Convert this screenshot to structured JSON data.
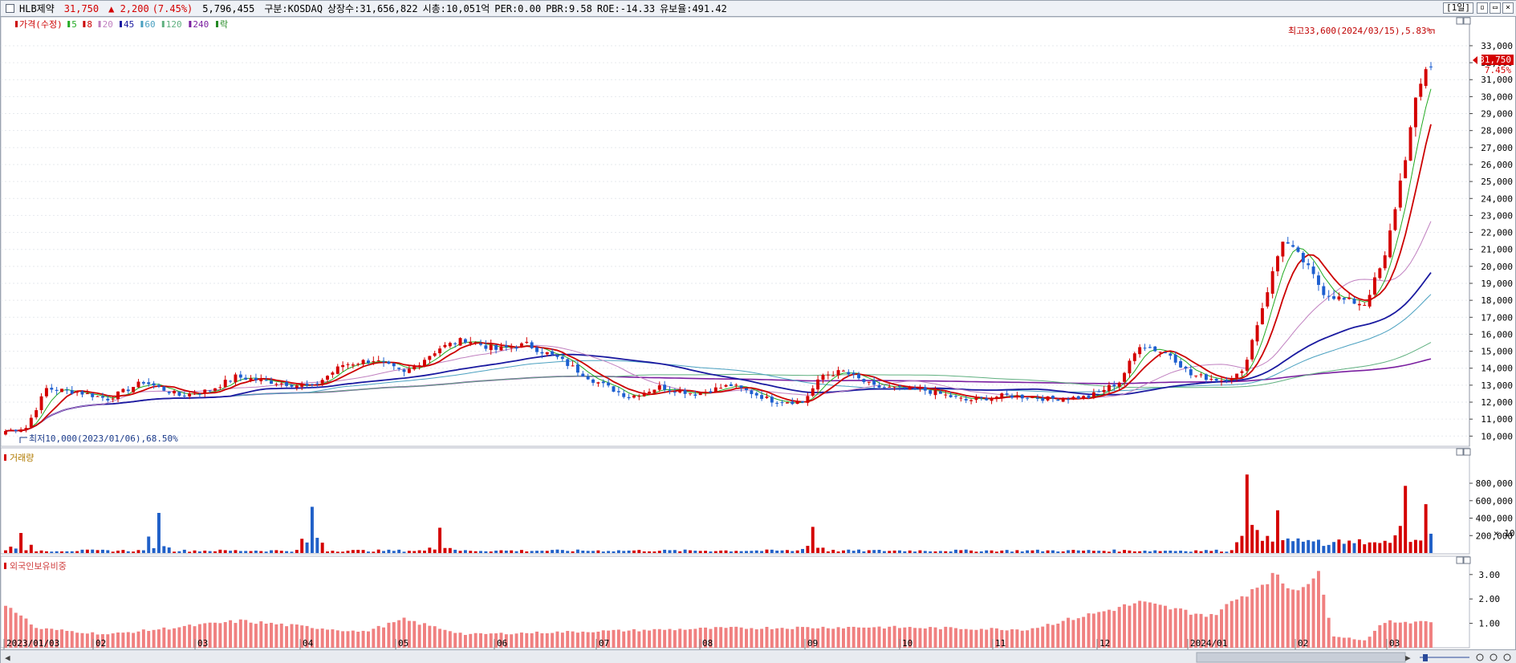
{
  "header": {
    "stock_name": "HLB제약",
    "price": "31,750",
    "change": "▲ 2,200",
    "change_pct": "(7.45%)",
    "volume": "5,796,455",
    "market": "구분:KOSDAQ",
    "shares": "상장수:31,656,822",
    "mktcap": "시총:10,051억",
    "per": "PER:0.00",
    "pbr": "PBR:9.58",
    "roe": "ROE:-14.33",
    "reserve": "유보율:491.42",
    "period": "[1일]"
  },
  "price_panel": {
    "legend": [
      {
        "label": "가격(수정)",
        "color": "#cc0000"
      },
      {
        "label": "5",
        "color": "#22aa22"
      },
      {
        "label": "8",
        "color": "#cc0000"
      },
      {
        "label": "20",
        "color": "#c080c0"
      },
      {
        "label": "45",
        "color": "#1a1aa0"
      },
      {
        "label": "60",
        "color": "#4aa0c0"
      },
      {
        "label": "120",
        "color": "#60b080"
      },
      {
        "label": "240",
        "color": "#7a1fa0"
      },
      {
        "label": "락",
        "color": "#228822"
      }
    ],
    "high_note": "최고33,600(2024/03/15),5.83%",
    "low_note": "최저10,000(2023/01/06),68.50%",
    "last_price_tag": "31,750",
    "last_pct_tag": "7.45%",
    "y_ticks": [
      "33,000",
      "32,000",
      "31,000",
      "30,000",
      "29,000",
      "28,000",
      "27,000",
      "26,000",
      "25,000",
      "24,000",
      "23,000",
      "22,000",
      "21,000",
      "20,000",
      "19,000",
      "18,000",
      "17,000",
      "16,000",
      "15,000",
      "14,000",
      "13,000",
      "12,000",
      "11,000",
      "10,000"
    ]
  },
  "volume_panel": {
    "title": "거래량",
    "y_ticks": [
      "800,000",
      "600,000",
      "400,000",
      "200,000"
    ],
    "unit": "× 10"
  },
  "foreign_panel": {
    "title": "외국인보유비중",
    "y_ticks": [
      "3.00",
      "2.00",
      "1.00"
    ]
  },
  "x_axis": {
    "labels": [
      "2023/01/03",
      "02",
      "03",
      "04",
      "05",
      "06",
      "07",
      "08",
      "09",
      "10",
      "11",
      "12",
      "2024/01",
      "02",
      "03"
    ]
  },
  "chart_data": {
    "type": "candlestick",
    "x_labels": [
      "2023/01/03",
      "02",
      "03",
      "04",
      "05",
      "06",
      "07",
      "08",
      "09",
      "10",
      "11",
      "12",
      "2024/01",
      "02",
      "03"
    ],
    "ylim": [
      9400,
      34700
    ],
    "price_anchors": [
      {
        "x": 0,
        "close": 10300
      },
      {
        "x": 4,
        "close": 10500
      },
      {
        "x": 8,
        "close": 12800
      },
      {
        "x": 14,
        "close": 12600
      },
      {
        "x": 20,
        "close": 12200
      },
      {
        "x": 27,
        "close": 13200
      },
      {
        "x": 34,
        "close": 12400
      },
      {
        "x": 40,
        "close": 12700
      },
      {
        "x": 45,
        "close": 13500
      },
      {
        "x": 52,
        "close": 13200
      },
      {
        "x": 60,
        "close": 12900
      },
      {
        "x": 66,
        "close": 14200
      },
      {
        "x": 72,
        "close": 14500
      },
      {
        "x": 78,
        "close": 13700
      },
      {
        "x": 85,
        "close": 15200
      },
      {
        "x": 90,
        "close": 15700
      },
      {
        "x": 96,
        "close": 15100
      },
      {
        "x": 102,
        "close": 15400
      },
      {
        "x": 108,
        "close": 14600
      },
      {
        "x": 115,
        "close": 13300
      },
      {
        "x": 122,
        "close": 12300
      },
      {
        "x": 128,
        "close": 12900
      },
      {
        "x": 135,
        "close": 12500
      },
      {
        "x": 142,
        "close": 13000
      },
      {
        "x": 150,
        "close": 12100
      },
      {
        "x": 156,
        "close": 12000
      },
      {
        "x": 160,
        "close": 13600
      },
      {
        "x": 164,
        "close": 13800
      },
      {
        "x": 170,
        "close": 12900
      },
      {
        "x": 180,
        "close": 12700
      },
      {
        "x": 188,
        "close": 12100
      },
      {
        "x": 196,
        "close": 12400
      },
      {
        "x": 204,
        "close": 12200
      },
      {
        "x": 212,
        "close": 12300
      },
      {
        "x": 218,
        "close": 13200
      },
      {
        "x": 222,
        "close": 15400
      },
      {
        "x": 228,
        "close": 14800
      },
      {
        "x": 232,
        "close": 13600
      },
      {
        "x": 238,
        "close": 13300
      },
      {
        "x": 242,
        "close": 13700
      },
      {
        "x": 246,
        "close": 17600
      },
      {
        "x": 250,
        "close": 21600
      },
      {
        "x": 254,
        "close": 20300
      },
      {
        "x": 258,
        "close": 18500
      },
      {
        "x": 262,
        "close": 18000
      },
      {
        "x": 266,
        "close": 17800
      },
      {
        "x": 270,
        "close": 20500
      },
      {
        "x": 274,
        "close": 26500
      },
      {
        "x": 276,
        "close": 29600
      },
      {
        "x": 278,
        "close": 31750
      }
    ],
    "price_high": 33600,
    "price_low": 10000,
    "volume_peaks_approx": [
      {
        "x": 3,
        "value": 230000
      },
      {
        "x": 30,
        "value": 460000
      },
      {
        "x": 60,
        "value": 530000
      },
      {
        "x": 85,
        "value": 290000
      },
      {
        "x": 158,
        "value": 300000
      },
      {
        "x": 243,
        "value": 900000
      },
      {
        "x": 249,
        "value": 490000
      },
      {
        "x": 274,
        "value": 770000
      },
      {
        "x": 278,
        "value": 560000
      }
    ],
    "foreign_ratio_anchors": [
      {
        "x": 0,
        "value": 1.85
      },
      {
        "x": 6,
        "value": 0.8
      },
      {
        "x": 20,
        "value": 0.55
      },
      {
        "x": 46,
        "value": 1.1
      },
      {
        "x": 70,
        "value": 0.65
      },
      {
        "x": 78,
        "value": 1.15
      },
      {
        "x": 90,
        "value": 0.55
      },
      {
        "x": 140,
        "value": 0.8
      },
      {
        "x": 170,
        "value": 0.85
      },
      {
        "x": 200,
        "value": 0.75
      },
      {
        "x": 222,
        "value": 1.85
      },
      {
        "x": 236,
        "value": 1.3
      },
      {
        "x": 248,
        "value": 2.95
      },
      {
        "x": 252,
        "value": 2.4
      },
      {
        "x": 257,
        "value": 2.95
      },
      {
        "x": 260,
        "value": 0.5
      },
      {
        "x": 266,
        "value": 0.3
      },
      {
        "x": 270,
        "value": 1.05
      },
      {
        "x": 279,
        "value": 1.1
      }
    ]
  }
}
